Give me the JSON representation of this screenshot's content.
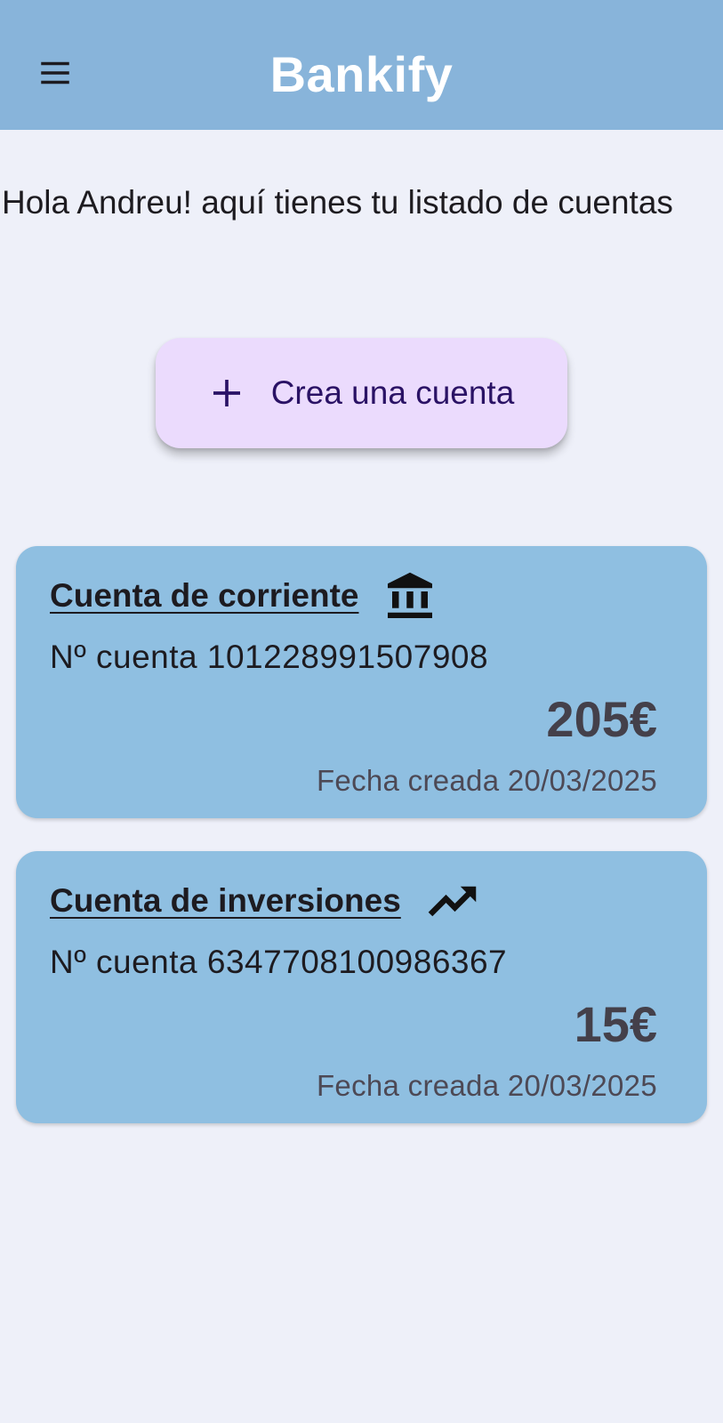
{
  "colors": {
    "background": "#eef0f9",
    "app_bar": "#88b4da",
    "app_title": "#ffffff",
    "card": "#8fbfe1",
    "create_button_bg": "#ebdbfd",
    "create_button_text": "#2a1265",
    "text_primary": "#1d1b20",
    "balance": "#44404a",
    "date": "#4d4955"
  },
  "app_bar": {
    "title": "Bankify",
    "menu_icon": "hamburger-menu-icon"
  },
  "greeting": "Hola Andreu! aquí tienes tu listado de cuentas",
  "create_button": {
    "icon": "plus-icon",
    "label": "Crea una cuenta"
  },
  "accounts": [
    {
      "title": "Cuenta de corriente",
      "icon": "bank-icon",
      "number": "Nº cuenta 101228991507908",
      "balance": "205€",
      "created": "Fecha creada 20/03/2025"
    },
    {
      "title": "Cuenta de inversiones",
      "icon": "trending-up-icon",
      "number": "Nº cuenta 6347708100986367",
      "balance": "15€",
      "created": "Fecha creada 20/03/2025"
    }
  ]
}
